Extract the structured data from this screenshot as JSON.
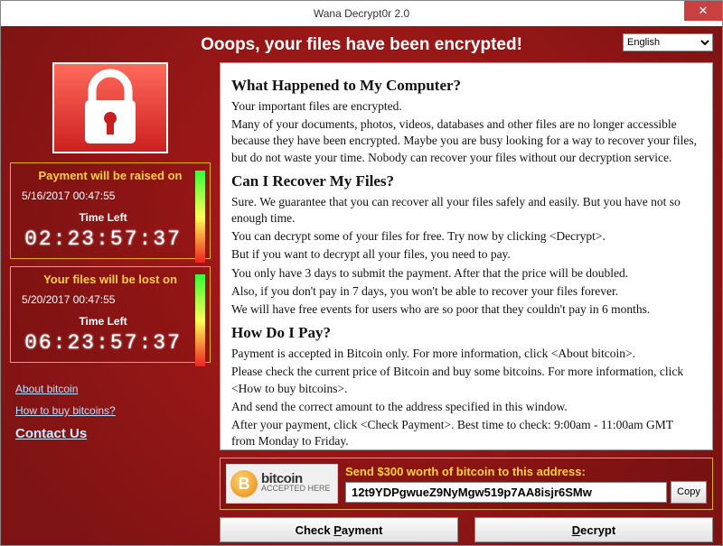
{
  "window": {
    "title": "Wana Decrypt0r 2.0"
  },
  "language_selected": "English",
  "headline": "Ooops, your files have been encrypted!",
  "countdown_raised": {
    "title": "Payment will be raised on",
    "date": "5/16/2017 00:47:55",
    "time_left_label": "Time Left",
    "timer": "02:23:57:37"
  },
  "countdown_lost": {
    "title": "Your files will be lost on",
    "date": "5/20/2017 00:47:55",
    "time_left_label": "Time Left",
    "timer": "06:23:57:37"
  },
  "links": {
    "about_bitcoin": "About bitcoin",
    "how_to_buy": "How to buy bitcoins?",
    "contact_us": "Contact Us"
  },
  "body": {
    "h1": "What Happened to My Computer?",
    "p1a": "Your important files are encrypted.",
    "p1b": "Many of your documents, photos, videos, databases and other files are no longer accessible because they have been encrypted. Maybe you are busy looking for a way to recover your files, but do not waste your time. Nobody can recover your files without our decryption service.",
    "h2": "Can I Recover My Files?",
    "p2a": "Sure. We guarantee that you can recover all your files safely and easily. But you have not so enough time.",
    "p2b": "You can decrypt some of your files for free. Try now by clicking <Decrypt>.",
    "p2c": "But if you want to decrypt all your files, you need to pay.",
    "p2d": "You only have 3 days to submit the payment. After that the price will be doubled.",
    "p2e": "Also, if you don't pay in 7 days, you won't be able to recover your files forever.",
    "p2f": "We will have free events for users who are so poor that they couldn't pay in 6 months.",
    "h3": "How Do I Pay?",
    "p3a": "Payment is accepted in Bitcoin only. For more information, click <About bitcoin>.",
    "p3b": "Please check the current price of Bitcoin and buy some bitcoins. For more information, click <How to buy bitcoins>.",
    "p3c": "And send the correct amount to the address specified in this window.",
    "p3d": "After your payment, click <Check Payment>. Best time to check: 9:00am - 11:00am GMT from Monday to Friday."
  },
  "payment": {
    "send_label": "Send $300 worth of bitcoin to this address:",
    "address": "12t9YDPgwueZ9NyMgw519p7AA8isjr6SMw",
    "badge_top": "bitcoin",
    "badge_bottom": "ACCEPTED HERE",
    "copy_label": "Copy"
  },
  "buttons": {
    "check_payment": "Check Payment",
    "decrypt": "Decrypt"
  }
}
